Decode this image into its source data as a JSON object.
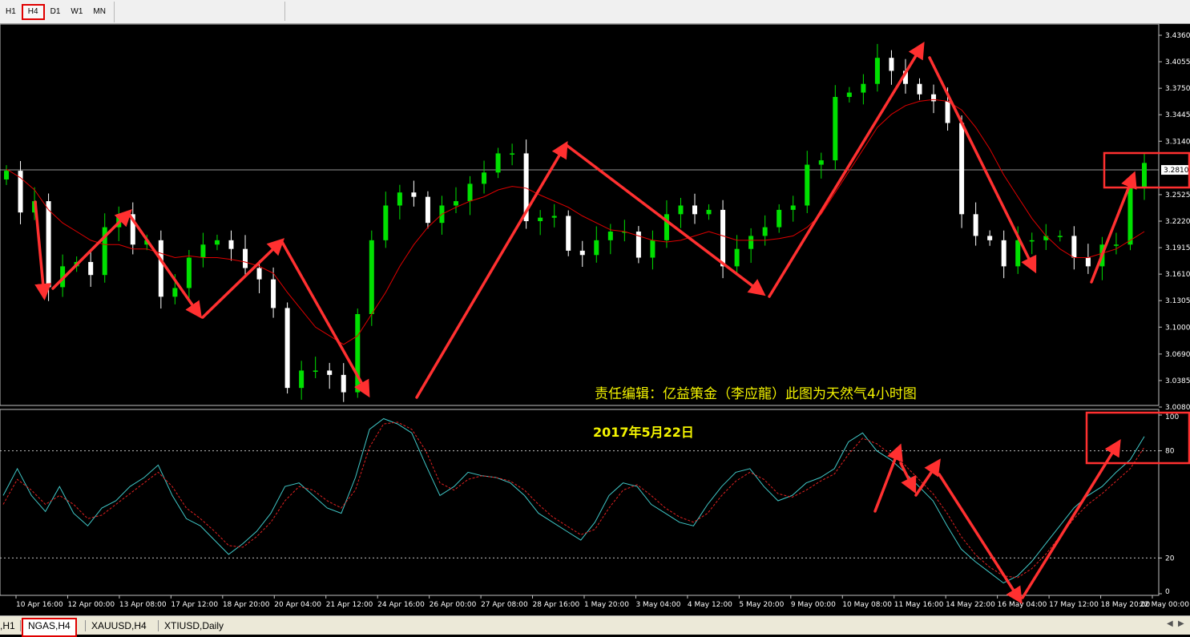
{
  "toolbar": {
    "timeframes": [
      {
        "label": "H1",
        "active": false
      },
      {
        "label": "H4",
        "active": true
      },
      {
        "label": "D1",
        "active": false
      },
      {
        "label": "W1",
        "active": false
      },
      {
        "label": "MN",
        "active": false
      }
    ]
  },
  "price_axis": {
    "labels": [
      "3.4360",
      "3.4055",
      "3.3750",
      "3.3445",
      "3.3140",
      "3.2525",
      "3.2220",
      "3.1915",
      "3.1610",
      "3.1305",
      "3.1000",
      "3.0690",
      "3.0385",
      "3.0080"
    ],
    "current_price": "3.2810"
  },
  "indicator_axis": {
    "labels": [
      "100",
      "80",
      "20",
      "0"
    ]
  },
  "time_axis": {
    "labels": [
      "10 Apr 16:00",
      "12 Apr 00:00",
      "13 Apr 08:00",
      "17 Apr 12:00",
      "18 Apr 20:00",
      "20 Apr 04:00",
      "21 Apr 12:00",
      "24 Apr 16:00",
      "26 Apr 00:00",
      "27 Apr 08:00",
      "28 Apr 16:00",
      "1 May 20:00",
      "3 May 04:00",
      "4 May 12:00",
      "5 May 20:00",
      "9 May 00:00",
      "10 May 08:00",
      "11 May 16:00",
      "14 May 22:00",
      "16 May 04:00",
      "17 May 12:00",
      "18 May 20:00",
      "22 May 00:00"
    ]
  },
  "annotations": {
    "caption": "责任编辑：亿益策金（李应龍）此图为天然气4小时图",
    "date": "2017年5月22日"
  },
  "colors": {
    "bull": "#00e000",
    "bear": "#ffffff",
    "ma": "#e00000",
    "stoch_main": "#40c8c8",
    "stoch_signal": "#e02020",
    "arrow": "#ff3030",
    "text": "#f4f400"
  },
  "tabs": [
    {
      "label": ",H1",
      "active": false
    },
    {
      "label": "NGAS,H4",
      "active": true
    },
    {
      "label": "XAUUSD,H4",
      "active": false
    },
    {
      "label": "XTIUSD,Daily",
      "active": false
    }
  ],
  "chart_data": {
    "type": "candlestick",
    "price_range": [
      3.008,
      3.436
    ],
    "stochastic_range": [
      0,
      100
    ],
    "stochastic_levels": [
      20,
      80
    ],
    "price_close_path": [
      3.28,
      3.232,
      3.245,
      3.146,
      3.17,
      3.175,
      3.16,
      3.215,
      3.23,
      3.195,
      3.2,
      3.135,
      3.145,
      3.18,
      3.195,
      3.2,
      3.19,
      3.168,
      3.155,
      3.122,
      3.03,
      3.05,
      3.05,
      3.045,
      3.025,
      3.115,
      3.2,
      3.24,
      3.255,
      3.25,
      3.22,
      3.24,
      3.245,
      3.265,
      3.278,
      3.3,
      3.3,
      3.222,
      3.226,
      3.228,
      3.188,
      3.183,
      3.2,
      3.21,
      3.21,
      3.18,
      3.2,
      3.23,
      3.24,
      3.23,
      3.235,
      3.17,
      3.19,
      3.205,
      3.215,
      3.235,
      3.24,
      3.287,
      3.292,
      3.365,
      3.37,
      3.38,
      3.41,
      3.395,
      3.38,
      3.368,
      3.36,
      3.335,
      3.23,
      3.205,
      3.2,
      3.17,
      3.2,
      3.2,
      3.205,
      3.205,
      3.18,
      3.17,
      3.195,
      3.195,
      3.26,
      3.289
    ],
    "ma_path": [
      3.282,
      3.272,
      3.258,
      3.235,
      3.22,
      3.21,
      3.2,
      3.195,
      3.195,
      3.19,
      3.19,
      3.185,
      3.18,
      3.182,
      3.18,
      3.18,
      3.178,
      3.175,
      3.17,
      3.162,
      3.14,
      3.12,
      3.1,
      3.09,
      3.08,
      3.09,
      3.115,
      3.14,
      3.17,
      3.195,
      3.215,
      3.23,
      3.238,
      3.245,
      3.25,
      3.258,
      3.262,
      3.26,
      3.252,
      3.245,
      3.238,
      3.228,
      3.22,
      3.212,
      3.21,
      3.205,
      3.2,
      3.198,
      3.2,
      3.205,
      3.21,
      3.205,
      3.2,
      3.2,
      3.2,
      3.202,
      3.205,
      3.215,
      3.23,
      3.255,
      3.28,
      3.305,
      3.33,
      3.345,
      3.355,
      3.36,
      3.362,
      3.36,
      3.35,
      3.33,
      3.305,
      3.275,
      3.25,
      3.225,
      3.205,
      3.19,
      3.18,
      3.18,
      3.185,
      3.19,
      3.2,
      3.21
    ],
    "stoch_main_path": [
      55,
      70,
      55,
      46,
      60,
      45,
      38,
      48,
      52,
      60,
      65,
      72,
      55,
      42,
      38,
      30,
      22,
      28,
      35,
      45,
      60,
      62,
      55,
      48,
      45,
      65,
      92,
      98,
      95,
      90,
      72,
      55,
      60,
      68,
      66,
      65,
      62,
      55,
      45,
      40,
      35,
      30,
      40,
      55,
      62,
      60,
      50,
      45,
      40,
      38,
      50,
      60,
      68,
      70,
      60,
      52,
      55,
      62,
      65,
      70,
      85,
      90,
      80,
      75,
      68,
      60,
      52,
      38,
      25,
      18,
      12,
      6,
      10,
      18,
      28,
      38,
      48,
      55,
      60,
      68,
      75,
      88
    ],
    "stoch_signal_path": [
      50,
      64,
      58,
      50,
      55,
      50,
      42,
      44,
      50,
      56,
      62,
      68,
      60,
      48,
      42,
      35,
      27,
      26,
      32,
      40,
      52,
      60,
      58,
      52,
      48,
      58,
      82,
      95,
      96,
      92,
      80,
      62,
      58,
      64,
      66,
      65,
      63,
      58,
      50,
      43,
      38,
      33,
      36,
      48,
      58,
      61,
      55,
      48,
      43,
      40,
      45,
      55,
      63,
      68,
      64,
      56,
      54,
      58,
      63,
      67,
      78,
      87,
      84,
      78,
      72,
      64,
      56,
      45,
      32,
      22,
      15,
      10,
      9,
      14,
      22,
      32,
      42,
      50,
      56,
      63,
      70,
      82
    ]
  }
}
